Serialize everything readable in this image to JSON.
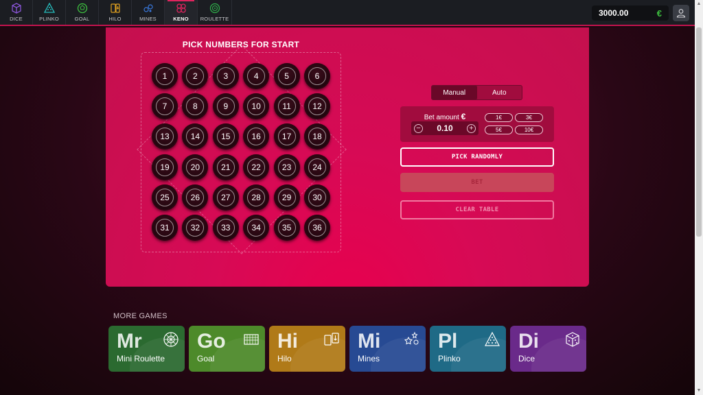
{
  "nav": {
    "items": [
      {
        "label": "DICE",
        "icon": "dice-icon",
        "color": "#8a55d8"
      },
      {
        "label": "PLINKO",
        "icon": "plinko-icon",
        "color": "#27c0c0"
      },
      {
        "label": "GOAL",
        "icon": "goal-icon",
        "color": "#3ec240"
      },
      {
        "label": "HILO",
        "icon": "hilo-icon",
        "color": "#e0a020"
      },
      {
        "label": "MINES",
        "icon": "mines-icon",
        "color": "#3a7ae0"
      },
      {
        "label": "KENO",
        "icon": "keno-icon",
        "color": "#e0245e",
        "active": true
      },
      {
        "label": "ROULETTE",
        "icon": "roulette-icon",
        "color": "#2fae4a"
      }
    ],
    "balance": "3000.00",
    "currency": "€"
  },
  "board": {
    "title": "PICK NUMBERS FOR START",
    "numbers": [
      "1",
      "2",
      "3",
      "4",
      "5",
      "6",
      "7",
      "8",
      "9",
      "10",
      "11",
      "12",
      "13",
      "14",
      "15",
      "16",
      "17",
      "18",
      "19",
      "20",
      "21",
      "22",
      "23",
      "24",
      "25",
      "26",
      "27",
      "28",
      "29",
      "30",
      "31",
      "32",
      "33",
      "34",
      "35",
      "36"
    ]
  },
  "controls": {
    "mode_manual": "Manual",
    "mode_auto": "Auto",
    "bet_label": "Bet amount",
    "bet_currency": "€",
    "bet_value": "0.10",
    "minus": "−",
    "plus": "+",
    "quick": [
      "1€",
      "3€",
      "5€",
      "10€"
    ],
    "pick_randomly": "PICK RANDOMLY",
    "bet": "BET",
    "clear_table": "CLEAR TABLE"
  },
  "more_games": {
    "title": "MORE GAMES",
    "cards": [
      {
        "abbr": "Mr",
        "name": "Mini Roulette",
        "icon": "roulette-wheel-icon",
        "color": "#2b6a30"
      },
      {
        "abbr": "Go",
        "name": "Goal",
        "icon": "goal-net-icon",
        "color": "#4d8a2a"
      },
      {
        "abbr": "Hi",
        "name": "Hilo",
        "icon": "cards-icon",
        "color": "#b07a18"
      },
      {
        "abbr": "Mi",
        "name": "Mines",
        "icon": "stars-icon",
        "color": "#274a93"
      },
      {
        "abbr": "Pl",
        "name": "Plinko",
        "icon": "pyramid-icon",
        "color": "#1f6a86"
      },
      {
        "abbr": "Di",
        "name": "Dice",
        "icon": "dice-icon",
        "color": "#6a2a8a"
      }
    ]
  },
  "colors": {
    "panel": "#d70a55",
    "accent": "#e0245e"
  }
}
